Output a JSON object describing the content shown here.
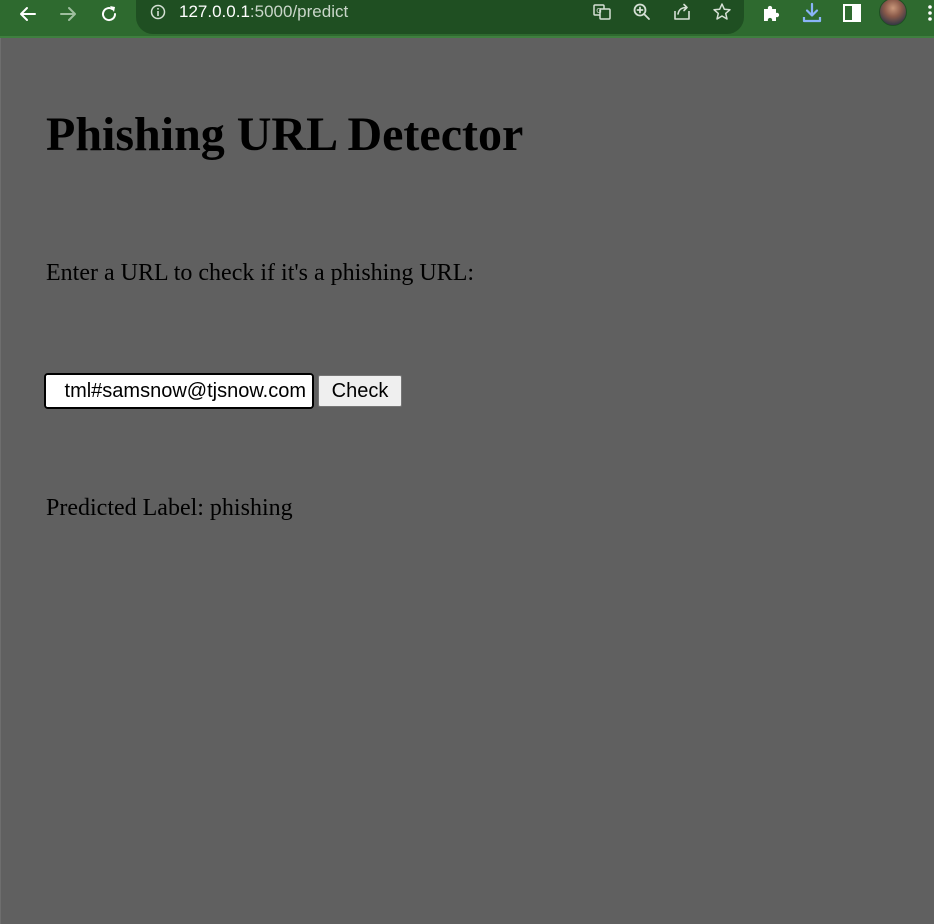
{
  "browser": {
    "url_host": "127.0.0.1",
    "url_rest": ":5000/predict",
    "toolbar_color": "#2e6a2f",
    "icons": {
      "back": "arrow-left-icon",
      "forward": "arrow-right-icon",
      "reload": "reload-icon",
      "site_info": "info-icon",
      "translate": "translate-icon",
      "zoom": "zoom-in-icon",
      "share": "share-icon",
      "bookmark": "star-icon",
      "extensions": "puzzle-icon",
      "downloads": "download-icon",
      "side_panel": "side-panel-icon",
      "profile": "avatar",
      "menu": "kebab-menu-icon"
    }
  },
  "page": {
    "background": "#606060",
    "title": "Phishing URL Detector",
    "instructions": "Enter a URL to check if it's a phishing URL:",
    "url_input_value": "tml#samsnow@tjsnow.com",
    "check_button_label": "Check",
    "prediction_text": "Predicted Label: phishing"
  }
}
